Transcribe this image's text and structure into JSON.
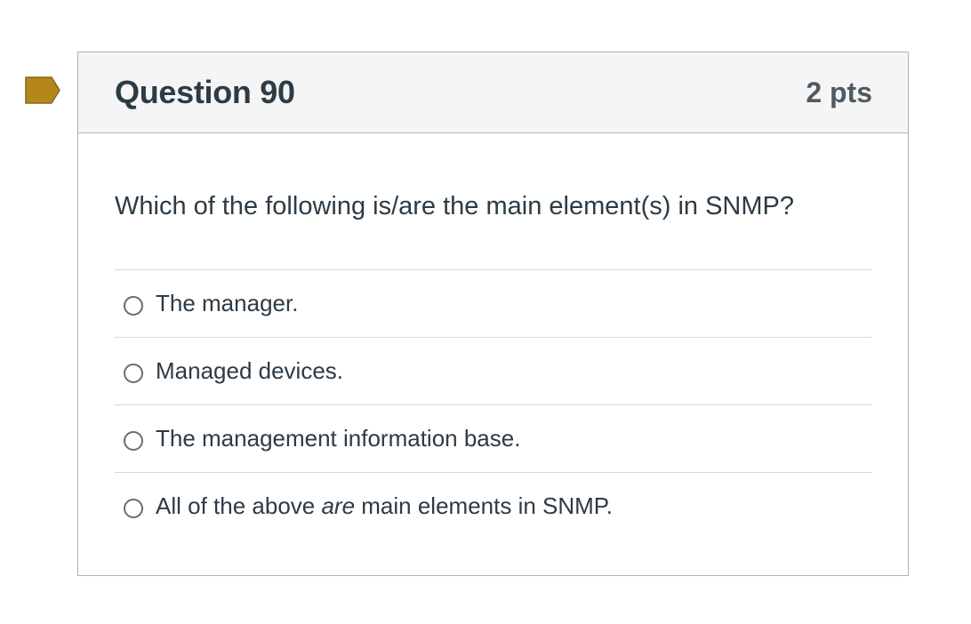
{
  "question": {
    "title": "Question 90",
    "points": "2 pts",
    "text": "Which of the following is/are the main element(s) in SNMP?",
    "flag_color": "#b5871b",
    "answers": [
      {
        "label": "The manager."
      },
      {
        "label": "Managed devices."
      },
      {
        "label": "The management information base."
      },
      {
        "label_before": "All of the above ",
        "label_italic": "are",
        "label_after": " main elements in SNMP."
      }
    ]
  }
}
